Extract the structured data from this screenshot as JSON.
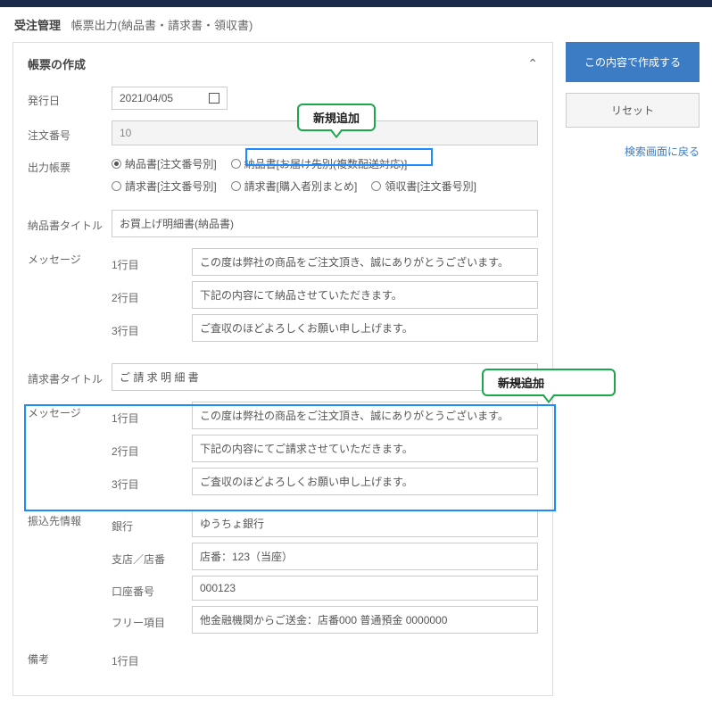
{
  "header": {
    "title": "受注管理",
    "subtitle": "帳票出力(納品書・請求書・領収書)"
  },
  "side": {
    "primary": "この内容で作成する",
    "secondary": "リセット",
    "link": "検索画面に戻る"
  },
  "card": {
    "title": "帳票の作成",
    "issue_date_label": "発行日",
    "issue_date": "2021/04/05",
    "order_no_label": "注文番号",
    "order_no": "10",
    "output_type_label": "出力帳票",
    "radios_row1": [
      {
        "label": "納品書[注文番号別]",
        "selected": true
      },
      {
        "label": "納品書[お届け先別(複数配送対応)]",
        "selected": false
      }
    ],
    "radios_row2": [
      {
        "label": "請求書[注文番号別]",
        "selected": false
      },
      {
        "label": "請求書[購入者別まとめ]",
        "selected": false
      },
      {
        "label": "領収書[注文番号別]",
        "selected": false
      }
    ],
    "deliv_title_label": "納品書タイトル",
    "deliv_title": "お買上げ明細書(納品書)",
    "message_label": "メッセージ",
    "line1": "1行目",
    "line2": "2行目",
    "line3": "3行目",
    "msg1": "この度は弊社の商品をご注文頂き、誠にありがとうございます。",
    "msg2": "下記の内容にて納品させていただきます。",
    "msg3": "ご査収のほどよろしくお願い申し上げます。",
    "bill_title_label": "請求書タイトル",
    "bill_title": "ご 請 求 明 細 書",
    "bmsg1": "この度は弊社の商品をご注文頂き、誠にありがとうございます。",
    "bmsg2": "下記の内容にてご請求させていただきます。",
    "bmsg3": "ご査収のほどよろしくお願い申し上げます。",
    "bank_label": "振込先情報",
    "bank_name_label": "銀行",
    "bank_name": "ゆうちょ銀行",
    "branch_label": "支店／店番",
    "branch": "店番：123（当座）",
    "account_label": "口座番号",
    "account": "000123",
    "free_label": "フリー項目",
    "free": "他金融機関からご送金：店番000 普通預金 0000000",
    "remarks_label": "備考"
  },
  "callouts": {
    "new1": "新規追加",
    "new2": "新規追加"
  }
}
